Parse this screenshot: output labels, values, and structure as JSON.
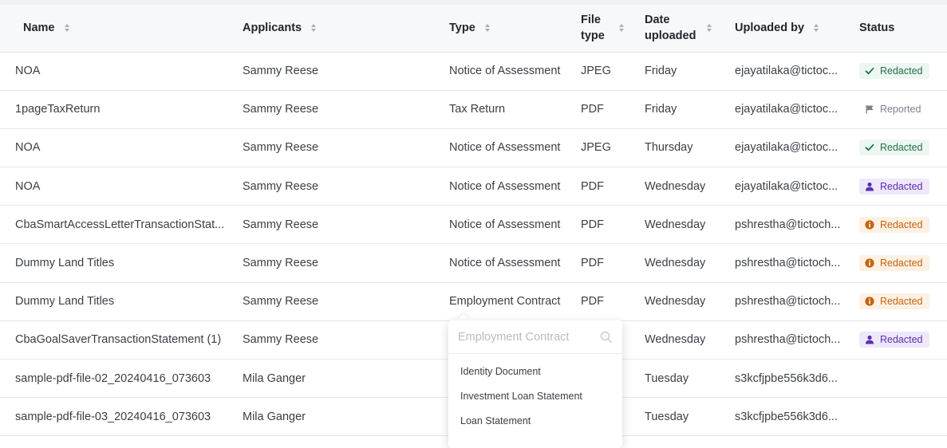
{
  "columns": {
    "name": "Name",
    "applicants": "Applicants",
    "type": "Type",
    "file_type_1": "File",
    "file_type_2": "type",
    "date_1": "Date",
    "date_2": "uploaded",
    "uploaded_by": "Uploaded by",
    "status": "Status"
  },
  "rows": [
    {
      "name": "NOA",
      "applicant": "Sammy Reese",
      "type": "Notice of Assessment",
      "file_type": "JPEG",
      "date": "Friday",
      "uploaded_by": "ejayatilaka@tictoc...",
      "status": "Redacted",
      "status_kind": "green"
    },
    {
      "name": "1pageTaxReturn",
      "applicant": "Sammy Reese",
      "type": "Tax Return",
      "file_type": "PDF",
      "date": "Friday",
      "uploaded_by": "ejayatilaka@tictoc...",
      "status": "Reported",
      "status_kind": "grey"
    },
    {
      "name": "NOA",
      "applicant": "Sammy Reese",
      "type": "Notice of Assessment",
      "file_type": "JPEG",
      "date": "Thursday",
      "uploaded_by": "ejayatilaka@tictoc...",
      "status": "Redacted",
      "status_kind": "green"
    },
    {
      "name": "NOA",
      "applicant": "Sammy Reese",
      "type": "Notice of Assessment",
      "file_type": "PDF",
      "date": "Wednesday",
      "uploaded_by": "ejayatilaka@tictoc...",
      "status": "Redacted",
      "status_kind": "purple"
    },
    {
      "name": "CbaSmartAccessLetterTransactionStat...",
      "applicant": "Sammy Reese",
      "type": "Notice of Assessment",
      "file_type": "PDF",
      "date": "Wednesday",
      "uploaded_by": "pshrestha@tictoch...",
      "status": "Redacted",
      "status_kind": "orange"
    },
    {
      "name": "Dummy Land Titles",
      "applicant": "Sammy Reese",
      "type": "Notice of Assessment",
      "file_type": "PDF",
      "date": "Wednesday",
      "uploaded_by": "pshrestha@tictoch...",
      "status": "Redacted",
      "status_kind": "orange"
    },
    {
      "name": "Dummy Land Titles",
      "applicant": "Sammy Reese",
      "type": "Employment Contract",
      "file_type": "PDF",
      "date": "Wednesday",
      "uploaded_by": "pshrestha@tictoch...",
      "status": "Redacted",
      "status_kind": "orange"
    },
    {
      "name": "CbaGoalSaverTransactionStatement (1)",
      "applicant": "Sammy Reese",
      "type": "",
      "file_type": "",
      "date": "Wednesday",
      "uploaded_by": "pshrestha@tictoch...",
      "status": "Redacted",
      "status_kind": "purple"
    },
    {
      "name": "sample-pdf-file-02_20240416_073603",
      "applicant": "Mila Ganger",
      "type": "",
      "file_type": "",
      "date": "Tuesday",
      "uploaded_by": "s3kcfjpbe556k3d6...",
      "status": "",
      "status_kind": "none"
    },
    {
      "name": "sample-pdf-file-03_20240416_073603",
      "applicant": "Mila Ganger",
      "type": "",
      "file_type": "",
      "date": "Tuesday",
      "uploaded_by": "s3kcfjpbe556k3d6...",
      "status": "",
      "status_kind": "none"
    }
  ],
  "type_dropdown": {
    "placeholder": "Employment Contract",
    "options": [
      "Identity Document",
      "Investment Loan Statement",
      "Loan Statement"
    ]
  },
  "colors": {
    "green": "#22704a",
    "purple": "#5a2fb0",
    "orange": "#c4640f",
    "grey": "#7b828a"
  },
  "icons": {
    "green": "check-icon",
    "grey": "flag-icon",
    "purple": "person-icon",
    "orange": "info-icon"
  }
}
